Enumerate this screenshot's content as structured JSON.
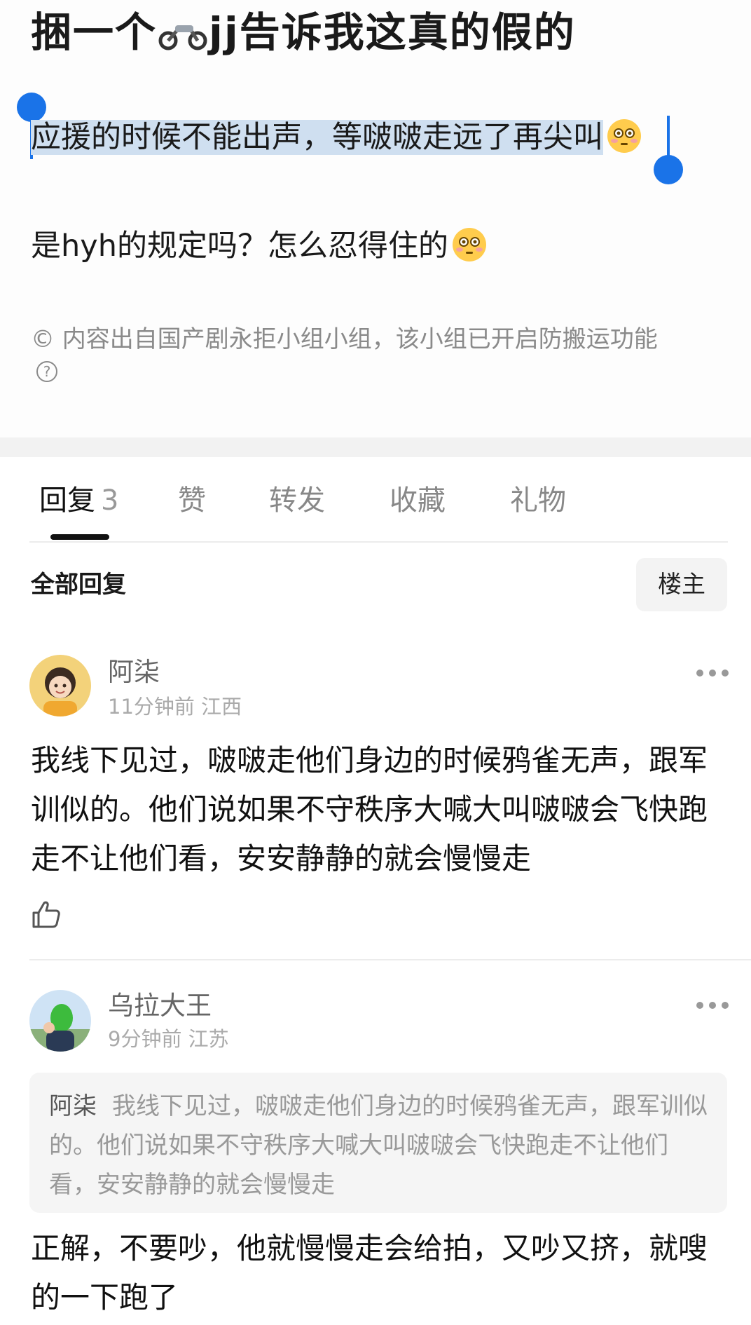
{
  "post": {
    "title_pre": "捆一个",
    "title_post": "jj告诉我这真的假的",
    "line1": "应援的时候不能出声，等啵啵走远了再尖叫",
    "line2": "是hyh的规定吗？怎么忍得住的",
    "copyright": "© 内容出自国产剧永拒小组小组，该小组已开启防搬运功能",
    "help_icon": "?"
  },
  "tabs": [
    {
      "label": "回复",
      "count": "3"
    },
    {
      "label": "赞"
    },
    {
      "label": "转发"
    },
    {
      "label": "收藏"
    },
    {
      "label": "礼物"
    }
  ],
  "filter": {
    "label": "全部回复",
    "owner_button": "楼主"
  },
  "comments": [
    {
      "name": "阿柒",
      "time": "11分钟前",
      "location": "江西",
      "body": "我线下见过，啵啵走他们身边的时候鸦雀无声，跟军训似的。他们说如果不守秩序大喊大叫啵啵会飞快跑走不让他们看，安安静静的就会慢慢走"
    },
    {
      "name": "乌拉大王",
      "time": "9分钟前",
      "location": "江苏",
      "quote_name": "阿柒",
      "quote_text": "我线下见过，啵啵走他们身边的时候鸦雀无声，跟军训似的。他们说如果不守秩序大喊大叫啵啵会飞快跑走不让他们看，安安静静的就会慢慢走",
      "body": "正解，不要吵，他就慢慢走会给拍，又吵又挤，就嗖的一下跑了"
    }
  ],
  "colors": {
    "accent_blue": "#1a73e8",
    "selection": "#cfdff0"
  }
}
